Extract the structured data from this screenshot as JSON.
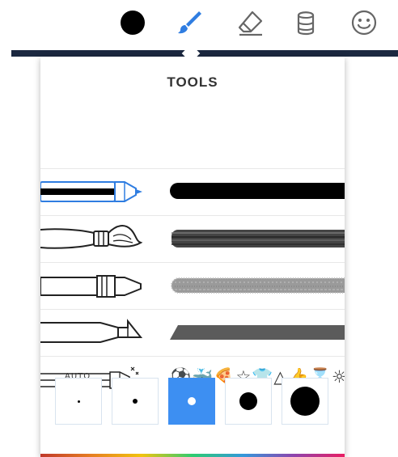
{
  "toolbar": {
    "current_color": "#000000",
    "active_tool_color": "#2f7de1",
    "icons": [
      "color-swatch",
      "brush-icon",
      "eraser-icon",
      "layers-icon",
      "sticker-icon"
    ]
  },
  "panel": {
    "title": "TOOLS",
    "tools": [
      {
        "name": "pen"
      },
      {
        "name": "paintbrush"
      },
      {
        "name": "crayon"
      },
      {
        "name": "marker"
      },
      {
        "name": "stamp",
        "label": "AUTO",
        "glyphs": "⚽🐳🍕☆👕△👍⌛☼"
      }
    ],
    "sizes": [
      {
        "selected": false
      },
      {
        "selected": false
      },
      {
        "selected": true
      },
      {
        "selected": false
      },
      {
        "selected": false
      }
    ],
    "selected_size_index": 2,
    "accent_color": "#3d8ff2"
  }
}
